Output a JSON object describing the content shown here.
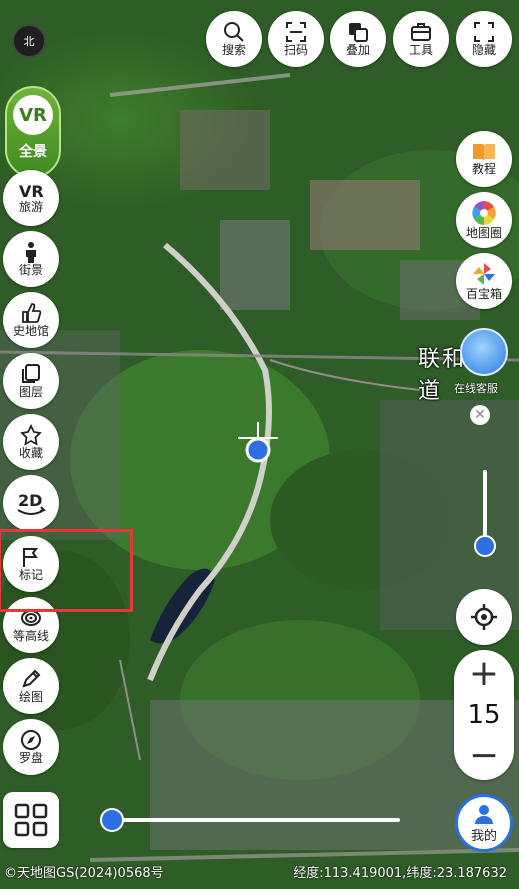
{
  "compass": {
    "label": "北",
    "icon": "compass-icon"
  },
  "top_toolbar": [
    {
      "label": "搜索",
      "icon": "search-icon"
    },
    {
      "label": "扫码",
      "icon": "scan-icon"
    },
    {
      "label": "叠加",
      "icon": "layers-overlay-icon"
    },
    {
      "label": "工具",
      "icon": "toolbox-icon"
    },
    {
      "label": "隐藏",
      "icon": "hide-icon"
    }
  ],
  "vr_panorama": {
    "badge": "VR",
    "label": "全景"
  },
  "left_tools": [
    {
      "label": "旅游",
      "icon": "vr-travel-icon"
    },
    {
      "label": "街景",
      "icon": "person-icon"
    },
    {
      "label": "史地馆",
      "icon": "thumbs-up-icon"
    },
    {
      "label": "图层",
      "icon": "layers-icon"
    },
    {
      "label": "收藏",
      "icon": "star-icon"
    },
    {
      "label": "2D",
      "icon": "rotate-2d-icon"
    },
    {
      "label": "标记",
      "icon": "flag-icon"
    },
    {
      "label": "等高线",
      "icon": "contour-icon"
    },
    {
      "label": "绘图",
      "icon": "pencil-icon"
    },
    {
      "label": "罗盘",
      "icon": "compass-needle-icon"
    }
  ],
  "right_tools": [
    {
      "label": "教程",
      "icon": "book-icon"
    },
    {
      "label": "地图圈",
      "icon": "aperture-icon"
    },
    {
      "label": "百宝箱",
      "icon": "pinwheel-icon"
    }
  ],
  "map": {
    "place_label": "联和",
    "place_label_suffix": "道",
    "customer_service_label": "在线客服"
  },
  "zoom": {
    "plus": "+",
    "level": "15",
    "minus": "−"
  },
  "me_button": {
    "label": "我的",
    "icon": "user-icon"
  },
  "copyright": "©天地图GS(2024)0568号",
  "coordinates": {
    "text": "经度:113.419001,纬度:23.187632"
  },
  "colors": {
    "accent_blue": "#2b6fe0",
    "selection_red": "#e03a3a",
    "vr_green": "#4e9a26"
  }
}
